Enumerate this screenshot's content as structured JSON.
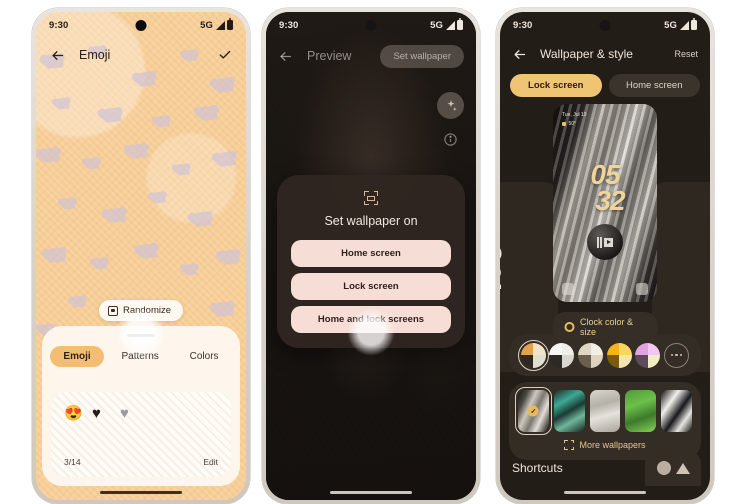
{
  "statusbar": {
    "time": "9:30",
    "network": "5G"
  },
  "phone1": {
    "title": "Emoji",
    "back_icon": "back-arrow-icon",
    "confirm_icon": "check-icon",
    "randomize": {
      "label": "Randomize",
      "icon": "dice-icon"
    },
    "tabs": [
      {
        "label": "Emoji",
        "active": true
      },
      {
        "label": "Patterns",
        "active": false
      },
      {
        "label": "Colors",
        "active": false
      }
    ],
    "emojis": [
      "😍",
      "♥",
      "♥"
    ],
    "counter": "3/14",
    "edit_label": "Edit",
    "accent": "#f3bd74",
    "background": "#f6cd96"
  },
  "phone2": {
    "title": "Preview",
    "back_icon": "back-arrow-icon",
    "set_wallpaper_label": "Set wallpaper",
    "effects_icon": "sparkles-icon",
    "info_icon": "info-icon",
    "dialog": {
      "icon": "wallpaper-icon",
      "title": "Set wallpaper on",
      "options": [
        {
          "label": "Home screen"
        },
        {
          "label": "Lock screen"
        },
        {
          "label": "Home and lock screens"
        }
      ],
      "option_color": "#f6ded6"
    }
  },
  "phone3": {
    "title": "Wallpaper & style",
    "back_icon": "back-arrow-icon",
    "reset_label": "Reset",
    "segments": [
      {
        "label": "Lock screen",
        "active": true
      },
      {
        "label": "Home screen",
        "active": false
      }
    ],
    "preview": {
      "date": "Tue, Jul 19",
      "weather": "50°",
      "clock_line1": "05",
      "clock_line2": "32",
      "now_playing_icon": "now-playing-icon",
      "shortcut_left_icon": "camera-icon",
      "shortcut_right_icon": "flashlight-icon"
    },
    "clock_config": {
      "label": "Clock color & size",
      "icon": "gear-icon"
    },
    "color_swatches": [
      {
        "name": "swatch-tan",
        "selected": true,
        "colors": [
          "#e0a44f",
          "#f0e3c9",
          "#2e2a22",
          "#dfe0d2"
        ]
      },
      {
        "name": "swatch-white",
        "selected": false,
        "colors": [
          "#f7f6f2",
          "#efeee9",
          "#2c2a27",
          "#d8d6d0"
        ]
      },
      {
        "name": "swatch-beige",
        "selected": false,
        "colors": [
          "#e1d6c3",
          "#f4efe4",
          "#6a5f4e",
          "#ddd3c0"
        ]
      },
      {
        "name": "swatch-amber",
        "selected": false,
        "colors": [
          "#f7b318",
          "#fbd55f",
          "#7a5a0c",
          "#f2e5b0"
        ]
      },
      {
        "name": "swatch-lilac",
        "selected": false,
        "colors": [
          "#e3a3e2",
          "#f0c8ef",
          "#5d4a5c",
          "#f2eec3"
        ]
      }
    ],
    "more_colors_label": "…",
    "wallpapers": [
      {
        "name": "wallpaper-feather",
        "selected": true
      },
      {
        "name": "wallpaper-teal-leaf",
        "selected": false
      },
      {
        "name": "wallpaper-grey-wood",
        "selected": false
      },
      {
        "name": "wallpaper-green-grass",
        "selected": false
      },
      {
        "name": "wallpaper-black-white",
        "selected": false
      }
    ],
    "more_wallpapers_label": "More wallpapers",
    "shortcuts_label": "Shortcuts",
    "accent": "#f0c475"
  }
}
